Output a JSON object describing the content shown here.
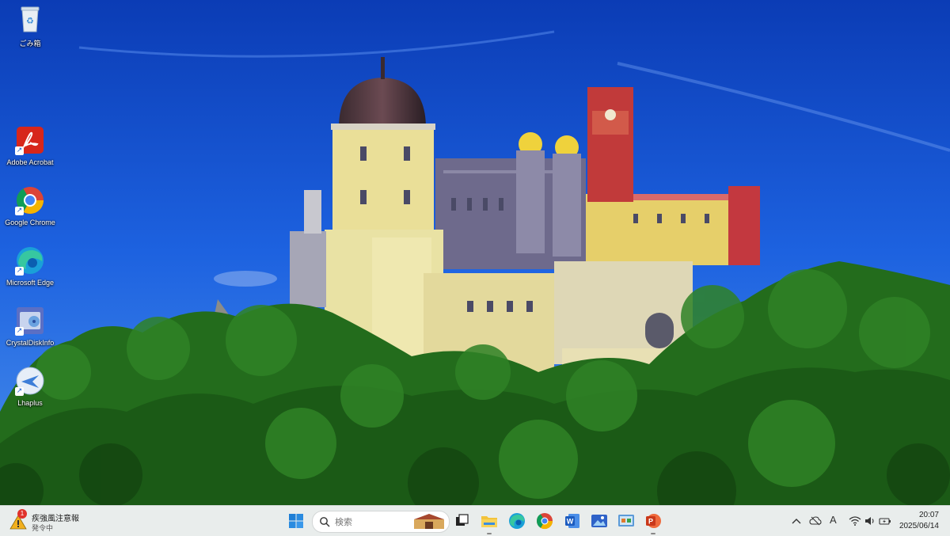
{
  "desktop": {
    "icons": [
      {
        "label": "ごみ箱",
        "icon": "recycle-bin-icon"
      },
      {
        "label": "Adobe Acrobat",
        "icon": "adobe-acrobat-icon"
      },
      {
        "label": "Google Chrome",
        "icon": "chrome-icon"
      },
      {
        "label": "Microsoft Edge",
        "icon": "edge-icon"
      },
      {
        "label": "CrystalDiskInfo",
        "icon": "crystaldiskinfo-icon"
      },
      {
        "label": "Lhaplus",
        "icon": "lhaplus-icon"
      }
    ]
  },
  "taskbar": {
    "weather": {
      "badge": "1",
      "title": "疾強風注意報",
      "subtitle": "発令中"
    },
    "search": {
      "placeholder": "検索"
    },
    "pinned": [
      "start-icon",
      "task-view-icon",
      "file-explorer-icon",
      "edge-icon",
      "chrome-icon",
      "word-icon",
      "photos-icon",
      "control-panel-icon",
      "powerpoint-icon"
    ],
    "tray": {
      "ime": "A"
    },
    "clock": {
      "time": "20:07",
      "date": "2025/06/14"
    }
  },
  "colors": {
    "sky": "#1656d8",
    "taskbar": "#e9edec",
    "accent": "#0067c0"
  }
}
